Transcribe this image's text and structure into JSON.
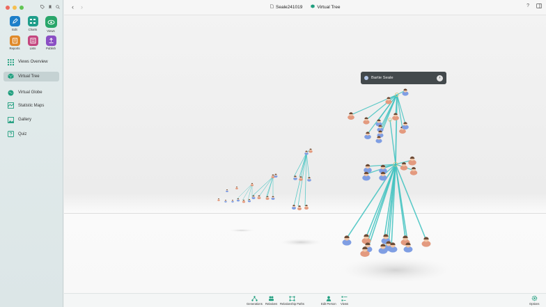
{
  "window": {
    "document_title": "Seale241019",
    "view_title": "Virtual Tree"
  },
  "toolbar_buttons": [
    {
      "label": "Edit",
      "icon": "pencil-icon",
      "color": "#1d7fc9"
    },
    {
      "label": "Charts",
      "icon": "charts-icon",
      "color": "#1f9e8a"
    },
    {
      "label": "Views",
      "icon": "eye-icon",
      "color": "#28a66a",
      "active": true
    },
    {
      "label": "Reports",
      "icon": "reports-icon",
      "color": "#e08a2a"
    },
    {
      "label": "Lists",
      "icon": "list-icon",
      "color": "#c4477f"
    },
    {
      "label": "Publish",
      "icon": "publish-icon",
      "color": "#8a4fc4"
    }
  ],
  "nav": [
    {
      "label": "Views Overview",
      "icon": "grid-icon"
    },
    {
      "label": "Virtual Tree",
      "icon": "cube-icon",
      "active": true
    },
    {
      "label": "Virtual Globe",
      "icon": "globe-icon"
    },
    {
      "label": "Statistic Maps",
      "icon": "map-icon"
    },
    {
      "label": "Gallery",
      "icon": "gallery-icon"
    },
    {
      "label": "Quiz",
      "icon": "quiz-icon"
    }
  ],
  "callout": {
    "name": "Bartie Seale"
  },
  "bottom_toolbar": [
    {
      "label": "Generations",
      "icon": "generations-icon"
    },
    {
      "label": "Relatives",
      "icon": "relatives-icon"
    },
    {
      "label": "Relationship Paths",
      "icon": "relationship-paths-icon"
    },
    {
      "label": "Edit Person",
      "icon": "person-icon"
    },
    {
      "label": "Views",
      "icon": "views-icon"
    },
    {
      "label": "Options",
      "icon": "gear-icon"
    }
  ],
  "colors": {
    "accent": "#1f9e7e",
    "link_line": "#3fc2c0"
  }
}
